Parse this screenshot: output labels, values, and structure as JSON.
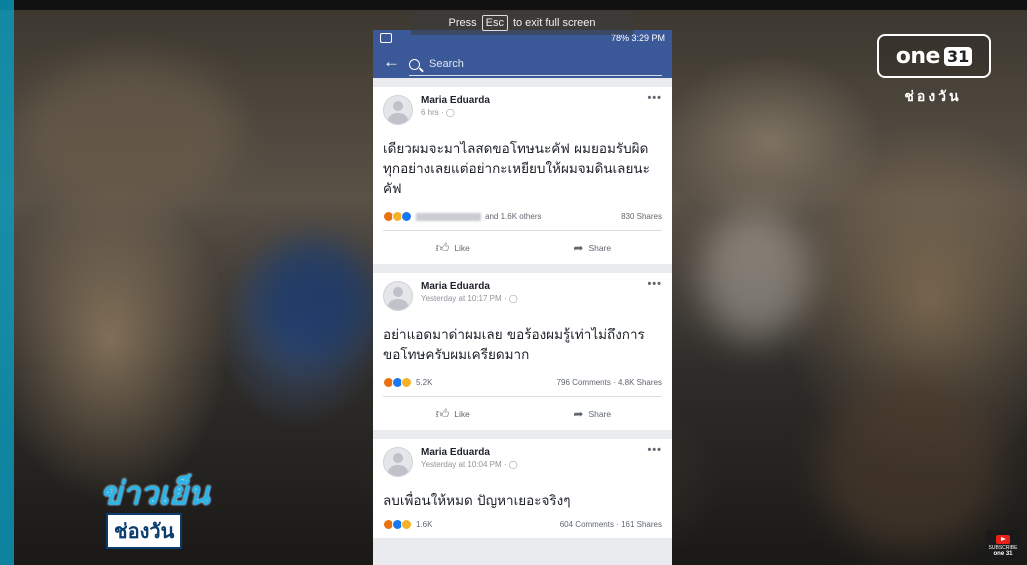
{
  "fullscreen_hint": {
    "before": "Press",
    "key": "Esc",
    "after": "to exit full screen"
  },
  "status_bar": {
    "right": "78% 3:29 PM"
  },
  "search": {
    "placeholder": "Search"
  },
  "posts": [
    {
      "author": "Maria Eduarda",
      "time": "6 hrs · ",
      "text": "เดียวผมจะมาไลสดขอโทษนะคัฟ ผมยอมรับผิดทุกอย่างเลยแต่อย่ากะเหยียบให้ผมจมดินเลยนะคัฟ",
      "reactions_text": "and 1.6K others",
      "right_stats": "830 Shares",
      "like_label": "Like",
      "share_label": "Share"
    },
    {
      "author": "Maria Eduarda",
      "time": "Yesterday at 10:17 PM · ",
      "text": "อย่าแอดมาด่าผมเลย ขอร้องผมรู้เท่าไม่ถึงการขอโทษครับผมเครียดมาก",
      "reactions_text": "5.2K",
      "right_stats": "796 Comments · 4.8K Shares",
      "like_label": "Like",
      "share_label": "Share"
    },
    {
      "author": "Maria Eduarda",
      "time": "Yesterday at 10:04 PM · ",
      "text": "ลบเพื่อนให้หมด ปัญหาเยอะจริงๆ",
      "reactions_text": "1.6K",
      "right_stats": "604 Comments · 161 Shares"
    }
  ],
  "channel_logo": {
    "one": "one",
    "num": "31",
    "sub": "ช่องวัน"
  },
  "program_logo": {
    "top": "ข่าวเย็น",
    "bottom": "ช่องวัน"
  },
  "subscribe": {
    "label": "SUBSCRIBE",
    "brand": "one 31"
  }
}
